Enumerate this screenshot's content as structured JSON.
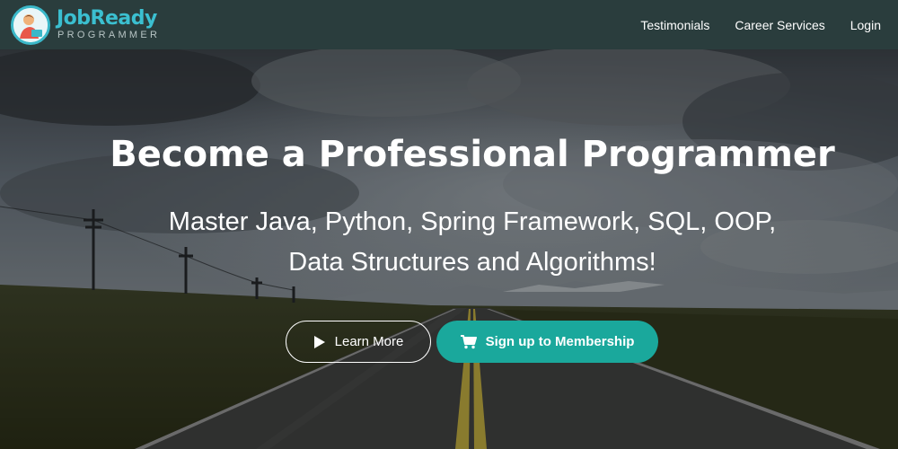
{
  "header": {
    "logo": {
      "title": "JobReady",
      "subtitle": "PROGRAMMER"
    },
    "nav": [
      {
        "label": "Testimonials"
      },
      {
        "label": "Career Services"
      },
      {
        "label": "Login"
      }
    ]
  },
  "hero": {
    "title": "Become a Professional Programmer",
    "subtitle_line1": "Master Java, Python, Spring Framework, SQL, OOP,",
    "subtitle_line2": "Data Structures and Algorithms!",
    "buttons": {
      "learn_more": {
        "label": "Learn More",
        "icon": "play-icon"
      },
      "signup": {
        "label": "Sign up to Membership",
        "icon": "cart-icon",
        "color": "#1aa89c"
      }
    }
  },
  "colors": {
    "header_bg": "#2a3d3d",
    "brand": "#3bbfd0",
    "accent": "#1aa89c"
  }
}
